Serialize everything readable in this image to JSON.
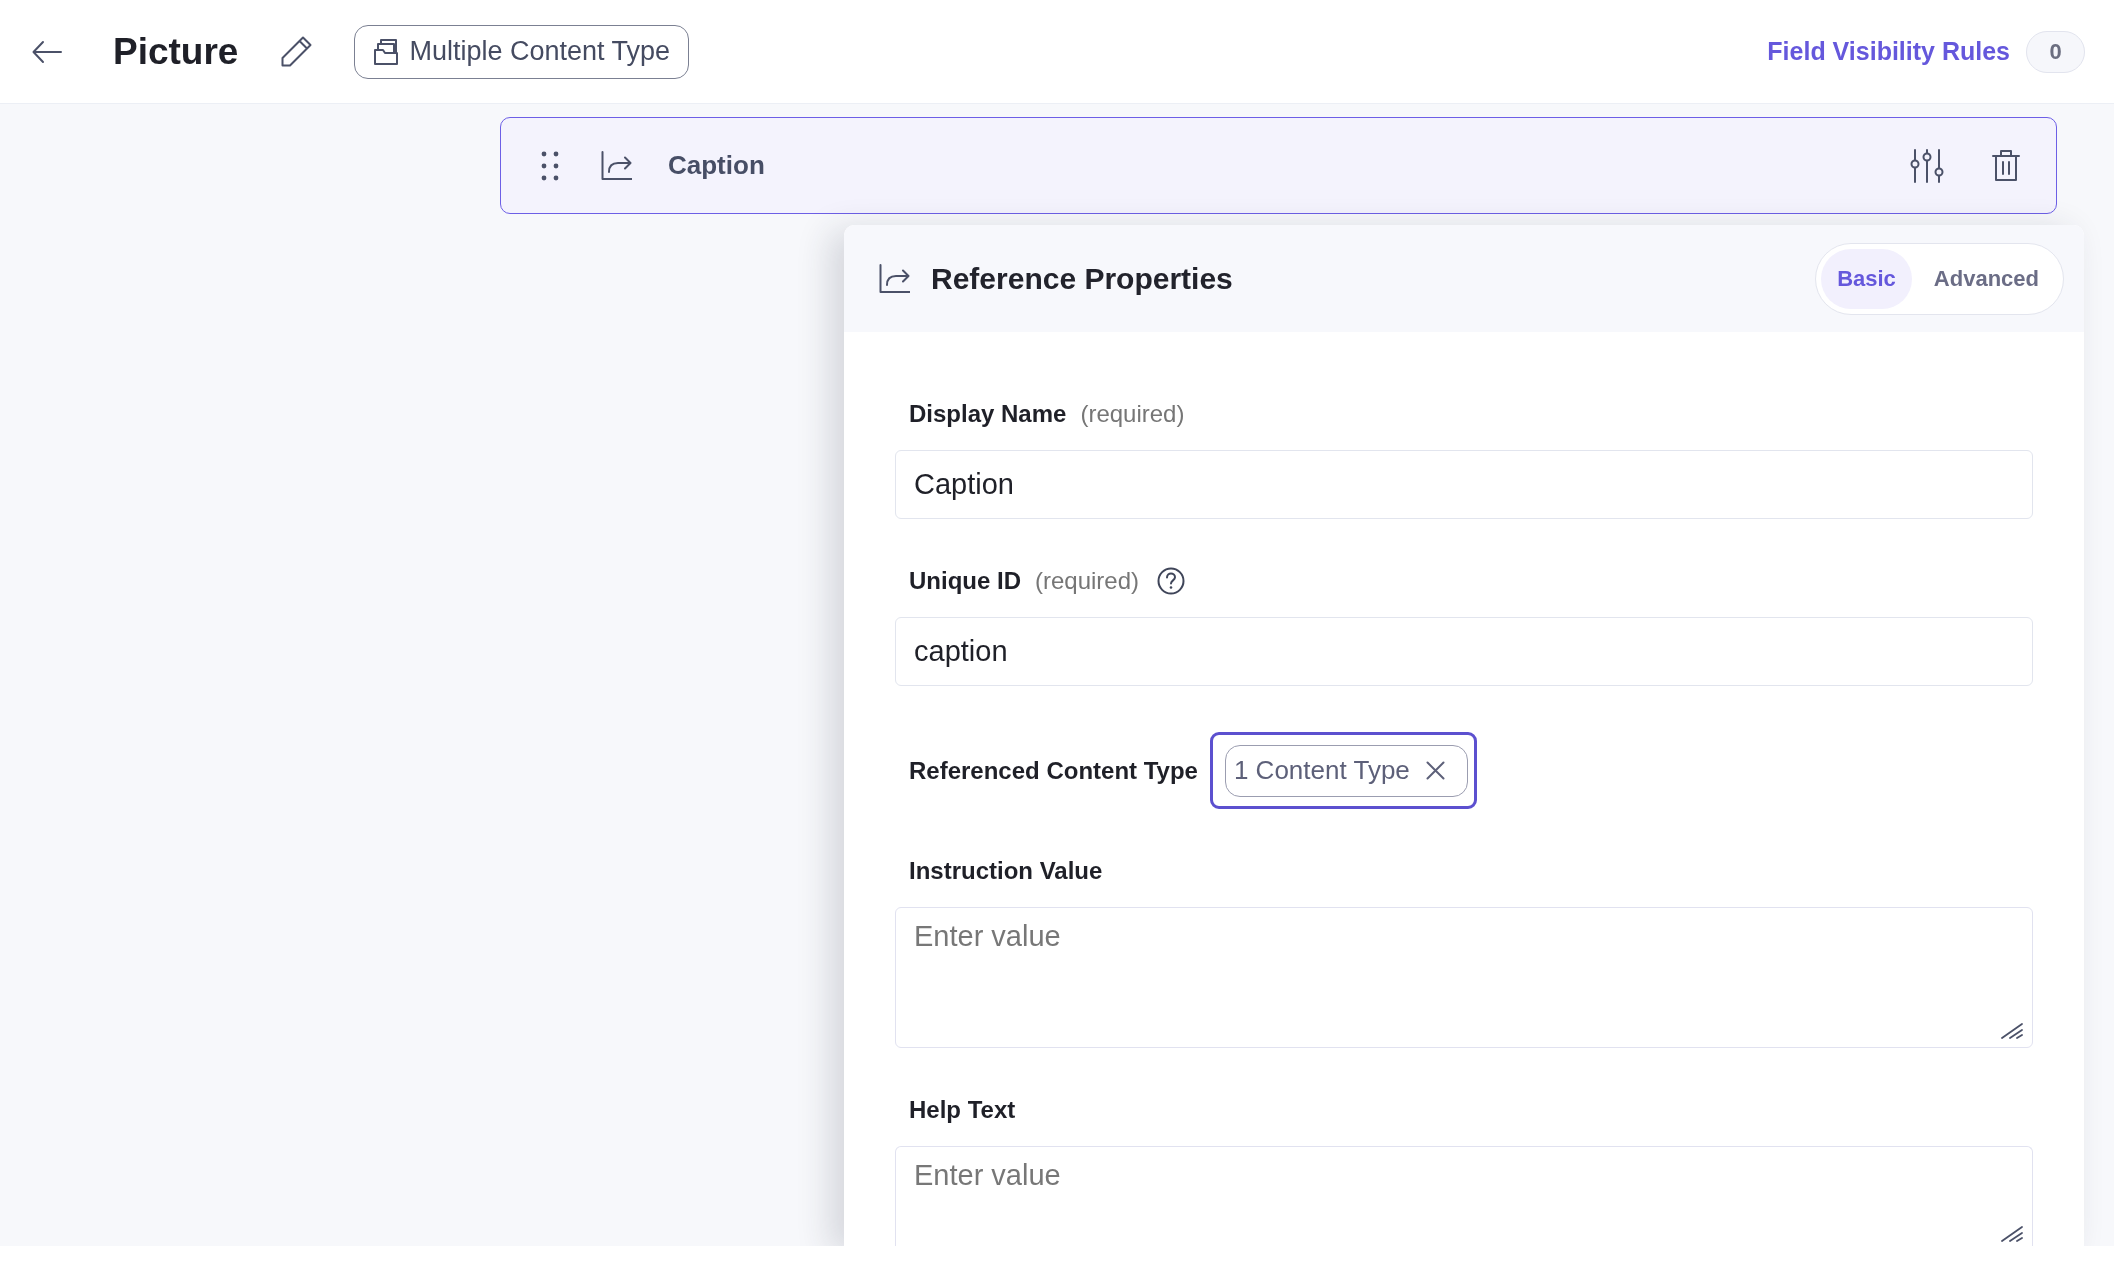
{
  "header": {
    "title": "Picture",
    "content_type": "Multiple Content Type",
    "visibility_rules": {
      "label": "Field Visibility Rules",
      "count": "0"
    }
  },
  "field_row": {
    "label": "Caption",
    "selected": true
  },
  "panel": {
    "title": "Reference Properties",
    "tabs": [
      {
        "label": "Basic",
        "selected": true
      },
      {
        "label": "Advanced",
        "selected": false
      }
    ],
    "fields": [
      {
        "kind": "text",
        "label": "Display Name",
        "note": "(required)",
        "help": false,
        "value": "Caption"
      },
      {
        "kind": "text",
        "label": "Unique ID",
        "note": "(required)",
        "help": true,
        "value": "caption"
      },
      {
        "kind": "chips",
        "label": "Referenced Content Type",
        "focused": true,
        "chips": [
          "1 Content Type"
        ]
      },
      {
        "kind": "textarea",
        "label": "Instruction Value",
        "placeholder": "Enter value"
      },
      {
        "kind": "textarea",
        "label": "Help Text",
        "placeholder": "Enter value"
      }
    ]
  }
}
